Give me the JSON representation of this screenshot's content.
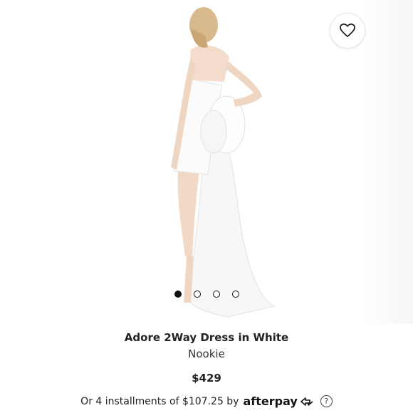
{
  "product": {
    "title": "Adore 2Way Dress in White",
    "brand": "Nookie",
    "price": "$429"
  },
  "gallery": {
    "image_count": 4,
    "active_index": 0
  },
  "payment": {
    "installments_text": "Or 4 installments of $107.25 by",
    "provider": "afterpay",
    "help_symbol": "?"
  },
  "icons": {
    "wishlist": "heart-outline-icon",
    "afterpay": "afterpay-arrows-icon",
    "help": "question-circle-icon"
  }
}
